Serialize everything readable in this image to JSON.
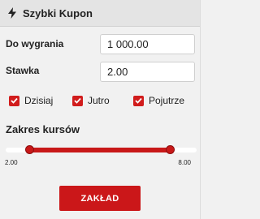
{
  "header": {
    "icon": "lightning-bolt-icon",
    "title": "Szybki Kupon"
  },
  "form": {
    "payout_label": "Do wygrania",
    "payout_value": "1 000.00",
    "stake_label": "Stawka",
    "stake_value": "2.00"
  },
  "days": [
    {
      "label": "Dzisiaj",
      "checked": true
    },
    {
      "label": "Jutro",
      "checked": true
    },
    {
      "label": "Pojutrze",
      "checked": true
    }
  ],
  "odds_range": {
    "title": "Zakres kursów",
    "min_label": "2.00",
    "max_label": "8.00",
    "track_min": 2.0,
    "track_max": 8.0,
    "selected_low": 2.1,
    "selected_high": 8.0
  },
  "submit_label": "ZAKŁAD",
  "colors": {
    "accent": "#c81818",
    "header_bg": "#e4e4e4",
    "panel_bg": "#f1f1f1"
  }
}
